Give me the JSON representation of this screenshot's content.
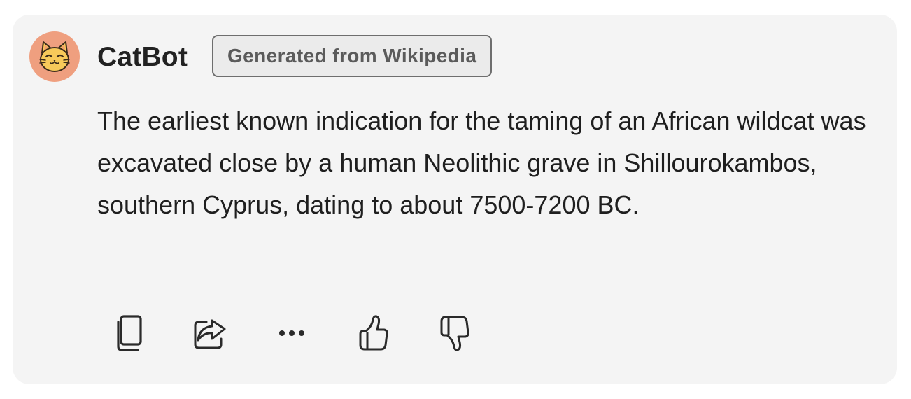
{
  "message": {
    "author": "CatBot",
    "badge": "Generated from Wikipedia",
    "text": "The earliest known indication for the taming of an African wildcat was excavated close by a human Neolithic grave in Shillourokambos, southern Cyprus, dating to about 7500-7200 BC.",
    "avatar_icon": "smiling-cat-face-icon"
  },
  "actions": [
    {
      "name": "copy",
      "icon": "copy-icon"
    },
    {
      "name": "share",
      "icon": "share-icon"
    },
    {
      "name": "more",
      "icon": "more-icon"
    },
    {
      "name": "like",
      "icon": "thumbs-up-icon"
    },
    {
      "name": "dislike",
      "icon": "thumbs-down-icon"
    }
  ],
  "colors": {
    "card_background": "#f4f4f4",
    "avatar_background": "#ef9f7f",
    "badge_border": "#6e6e6e",
    "text": "#1f1f1f"
  }
}
